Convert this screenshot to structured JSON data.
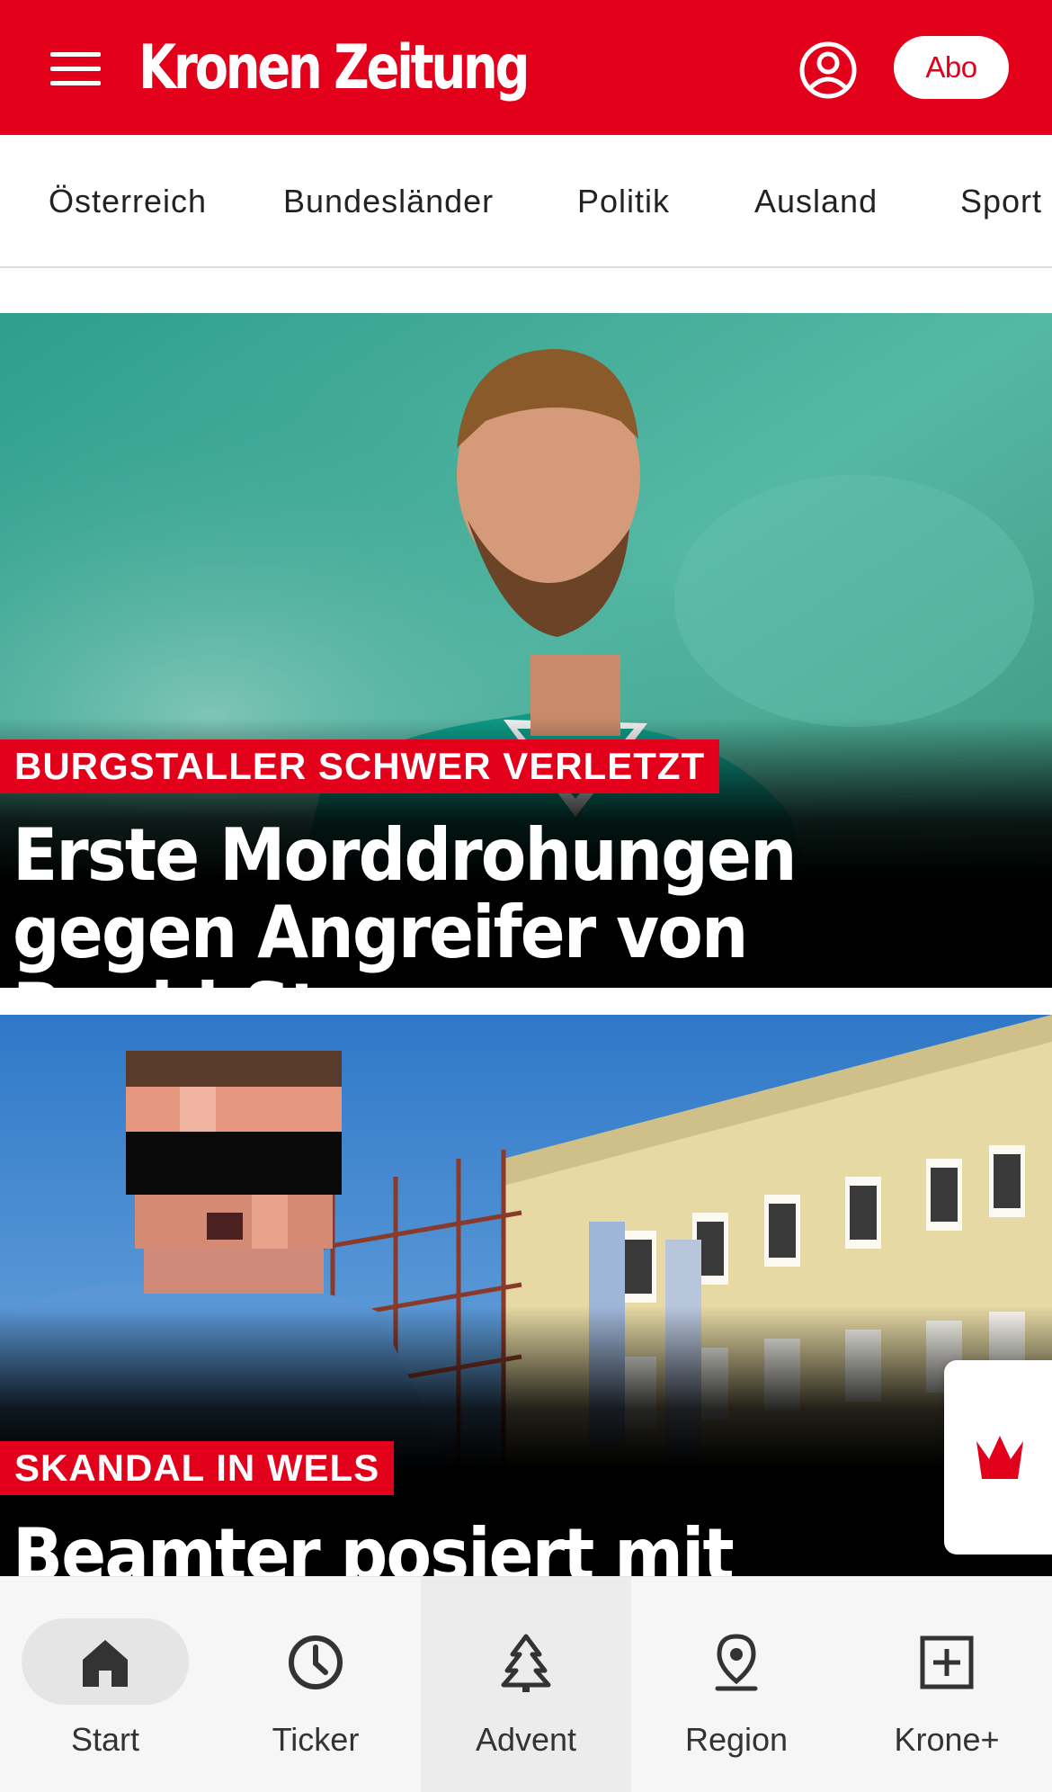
{
  "header": {
    "logo_text": "Kronen Zeitung",
    "abo_label": "Abo",
    "brand_color": "#e3001b"
  },
  "categories": [
    "Österreich",
    "Bundesländer",
    "Politik",
    "Ausland",
    "Sport"
  ],
  "articles": [
    {
      "kicker": "BURGSTALLER SCHWER VERLETZT",
      "headline": "Erste Morddrohungen gegen Angreifer von Rapid-Star"
    },
    {
      "kicker": "SKANDAL IN WELS",
      "headline": "Beamter posiert mit"
    }
  ],
  "bottom_nav": [
    {
      "label": "Start",
      "icon": "home-icon",
      "active": true
    },
    {
      "label": "Ticker",
      "icon": "clock-icon"
    },
    {
      "label": "Advent",
      "icon": "tree-icon"
    },
    {
      "label": "Region",
      "icon": "location-pin-icon"
    },
    {
      "label": "Krone+",
      "icon": "plus-box-icon"
    }
  ]
}
